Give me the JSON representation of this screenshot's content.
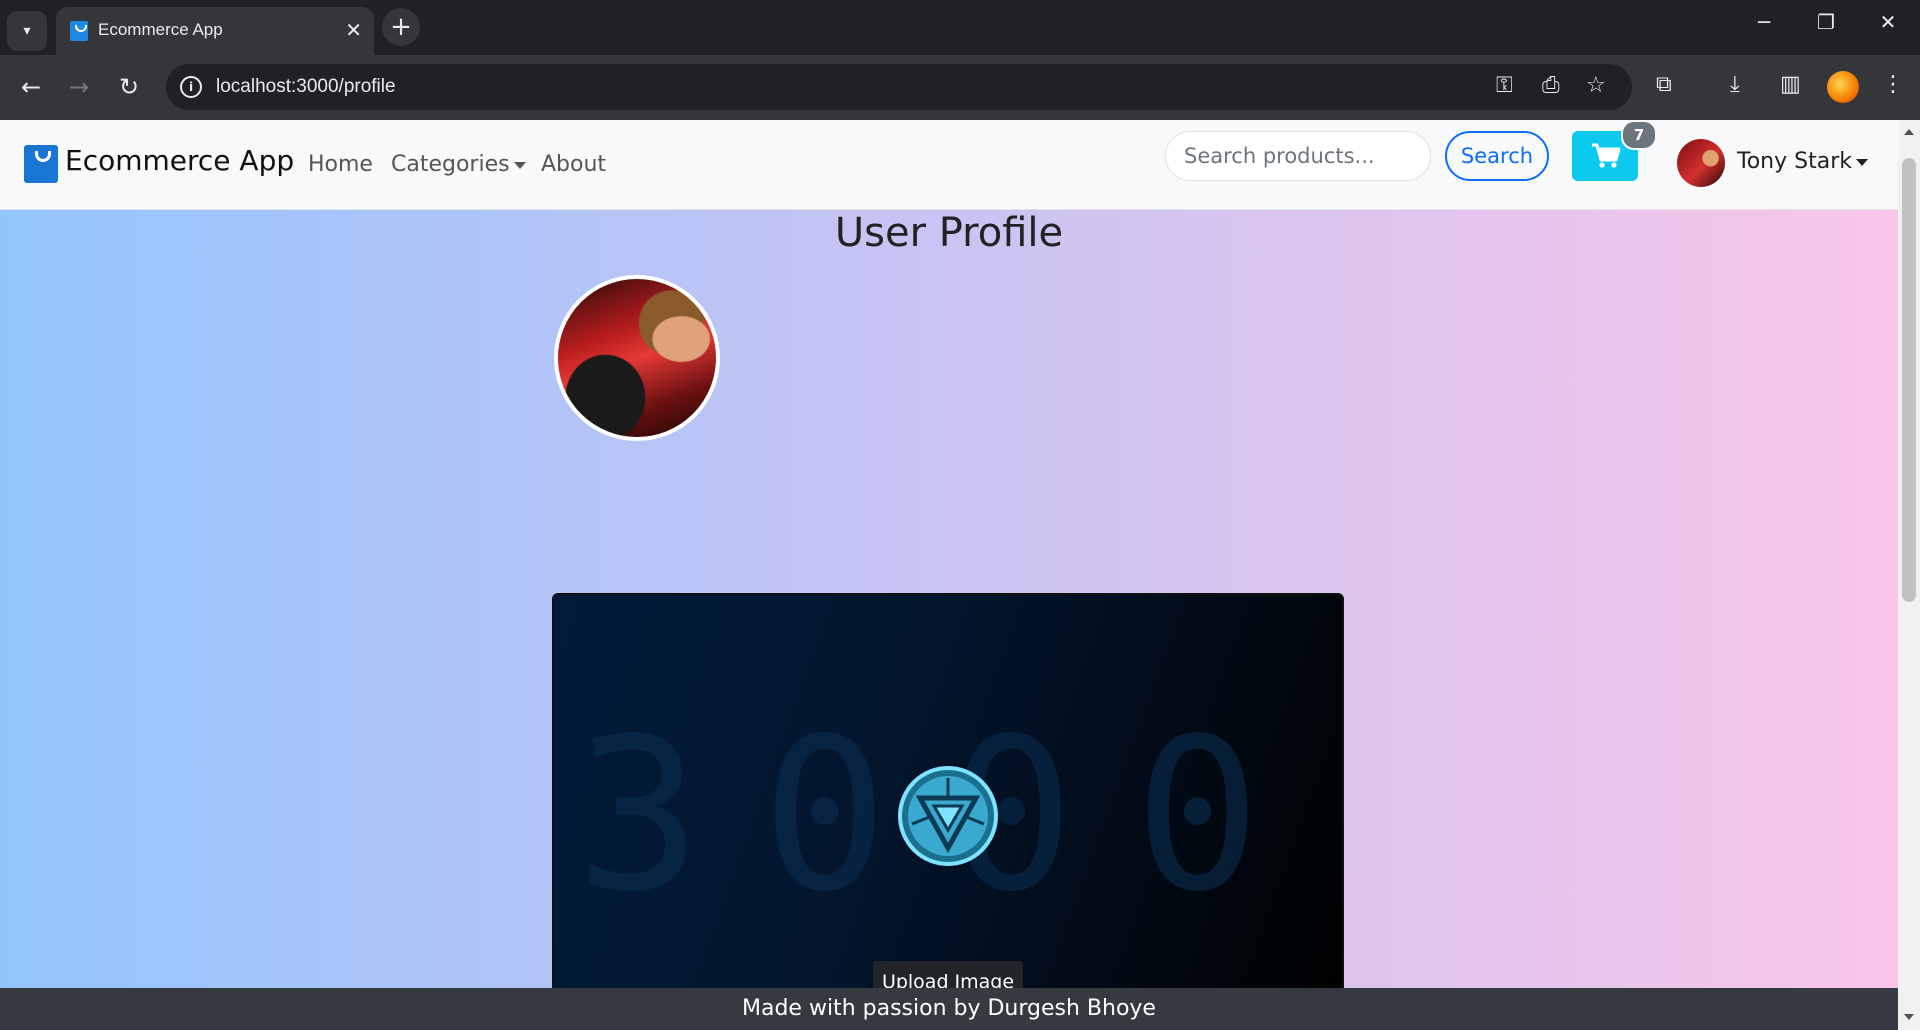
{
  "browser": {
    "tab_title": "Ecommerce App",
    "url": "localhost:3000/profile"
  },
  "navbar": {
    "brand": "Ecommerce App",
    "links": [
      "Home",
      "Categories",
      "About"
    ],
    "search_placeholder": "Search products...",
    "search_label": "Search",
    "cart_count": "7",
    "user_name": "Tony Stark"
  },
  "profile": {
    "title": "User Profile",
    "preview_bg_text": "3000",
    "upload_label": "Upload Image"
  },
  "footer": {
    "text": "Made with passion by  Durgesh Bhoye"
  },
  "colors": {
    "accent": "#0d6efd",
    "cart": "#0dcaf0",
    "footer": "#343a40",
    "gradient_start": "#93c5fd",
    "gradient_end": "#f9c6e8"
  }
}
